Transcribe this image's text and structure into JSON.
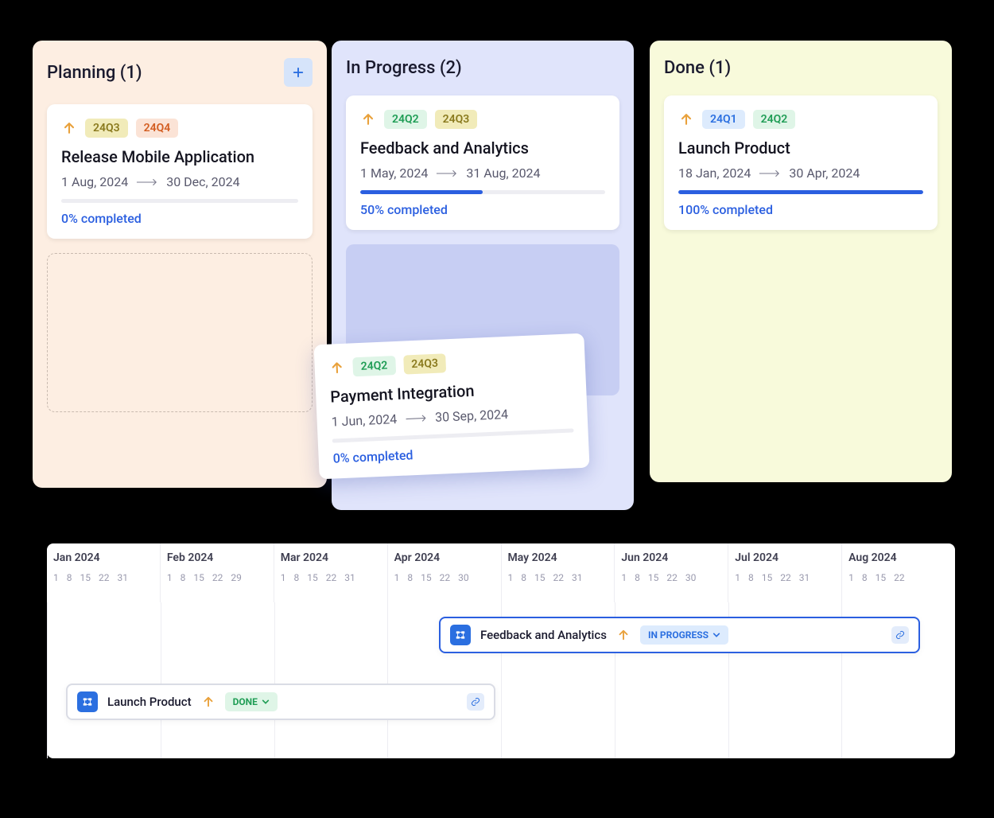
{
  "columns": {
    "planning": {
      "title": "Planning (1)"
    },
    "inprogress": {
      "title": "In Progress (2)"
    },
    "done": {
      "title": "Done (1)"
    }
  },
  "cards": {
    "release": {
      "tag1": "24Q3",
      "tag2": "24Q4",
      "title": "Release Mobile Application",
      "start": "1 Aug, 2024",
      "end": "30 Dec, 2024",
      "progress": "0% completed",
      "pct": 0
    },
    "feedback": {
      "tag1": "24Q2",
      "tag2": "24Q3",
      "title": "Feedback and Analytics",
      "start": "1 May, 2024",
      "end": "31 Aug, 2024",
      "progress": "50% completed",
      "pct": 50
    },
    "payment": {
      "tag1": "24Q2",
      "tag2": "24Q3",
      "title": "Payment Integration",
      "start": "1 Jun, 2024",
      "end": "30 Sep, 2024",
      "progress": "0% completed",
      "pct": 0
    },
    "launch": {
      "tag1": "24Q1",
      "tag2": "24Q2",
      "title": "Launch Product",
      "start": "18 Jan, 2024",
      "end": "30 Apr, 2024",
      "progress": "100% completed",
      "pct": 100
    }
  },
  "timeline": {
    "months": [
      {
        "name": "Jan 2024",
        "days": [
          "1",
          "8",
          "15",
          "22",
          "31"
        ]
      },
      {
        "name": "Feb 2024",
        "days": [
          "1",
          "8",
          "15",
          "22",
          "29"
        ]
      },
      {
        "name": "Mar 2024",
        "days": [
          "1",
          "8",
          "15",
          "22",
          "31"
        ]
      },
      {
        "name": "Apr 2024",
        "days": [
          "1",
          "8",
          "15",
          "22",
          "30"
        ]
      },
      {
        "name": "May 2024",
        "days": [
          "1",
          "8",
          "15",
          "22",
          "31"
        ]
      },
      {
        "name": "Jun 2024",
        "days": [
          "1",
          "8",
          "15",
          "22",
          "30"
        ]
      },
      {
        "name": "Jul 2024",
        "days": [
          "1",
          "8",
          "15",
          "22",
          "31"
        ]
      },
      {
        "name": "Aug 2024",
        "days": [
          "1",
          "8",
          "15",
          "22"
        ]
      }
    ],
    "bars": {
      "feedback": {
        "title": "Feedback and Analytics",
        "status": "IN PROGRESS"
      },
      "launch": {
        "title": "Launch Product",
        "status": "DONE"
      }
    }
  }
}
